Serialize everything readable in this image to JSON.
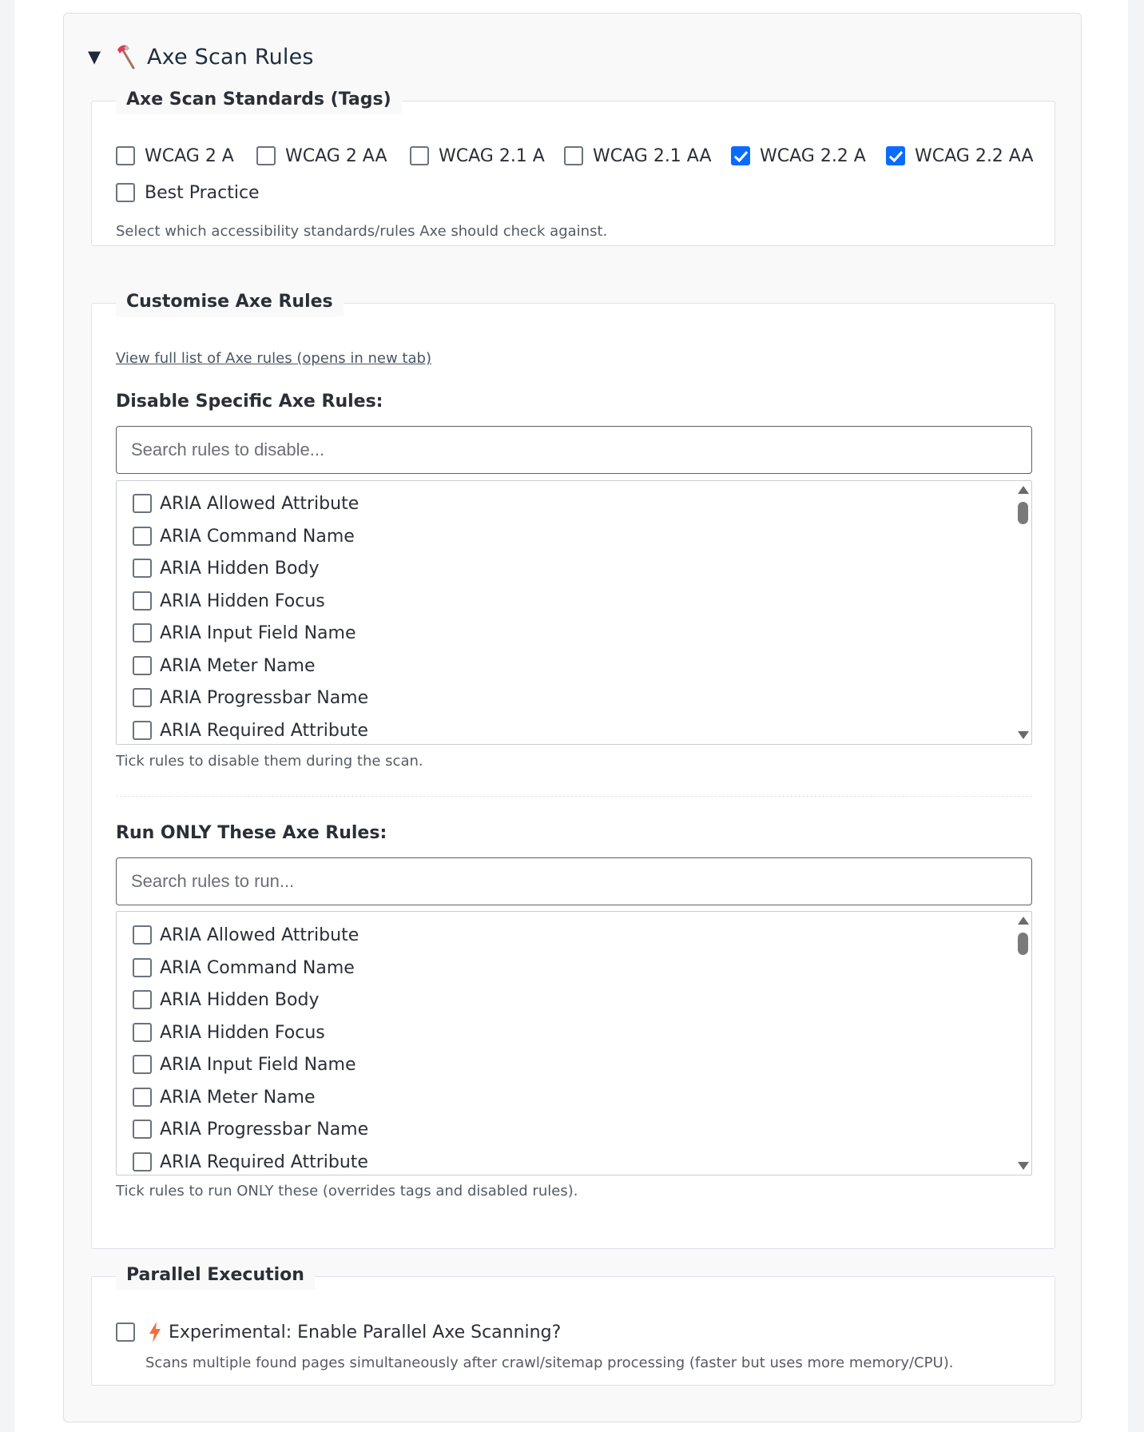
{
  "section": {
    "title": "Axe Scan Rules",
    "icon": "axe-icon",
    "expanded": true
  },
  "standards": {
    "legend": "Axe Scan Standards (Tags)",
    "tags": [
      {
        "label": "WCAG 2 A",
        "checked": false
      },
      {
        "label": "WCAG 2 AA",
        "checked": false
      },
      {
        "label": "WCAG 2.1 A",
        "checked": false
      },
      {
        "label": "WCAG 2.1 AA",
        "checked": false
      },
      {
        "label": "WCAG 2.2 A",
        "checked": true
      },
      {
        "label": "WCAG 2.2 AA",
        "checked": true
      },
      {
        "label": "Best Practice",
        "checked": false
      }
    ],
    "help": "Select which accessibility standards/rules Axe should check against."
  },
  "customise": {
    "legend": "Customise Axe Rules",
    "link_text": "View full list of Axe rules (opens in new tab)",
    "disable": {
      "heading": "Disable Specific Axe Rules:",
      "placeholder": "Search rules to disable...",
      "help": "Tick rules to disable them during the scan.",
      "rules": [
        "ARIA Allowed Attribute",
        "ARIA Command Name",
        "ARIA Hidden Body",
        "ARIA Hidden Focus",
        "ARIA Input Field Name",
        "ARIA Meter Name",
        "ARIA Progressbar Name",
        "ARIA Required Attribute"
      ]
    },
    "run_only": {
      "heading": "Run ONLY These Axe Rules:",
      "placeholder": "Search rules to run...",
      "help": "Tick rules to run ONLY these (overrides tags and disabled rules).",
      "rules": [
        "ARIA Allowed Attribute",
        "ARIA Command Name",
        "ARIA Hidden Body",
        "ARIA Hidden Focus",
        "ARIA Input Field Name",
        "ARIA Meter Name",
        "ARIA Progressbar Name",
        "ARIA Required Attribute"
      ]
    }
  },
  "parallel": {
    "legend": "Parallel Execution",
    "icon": "lightning-bolt-icon",
    "label": "Experimental: Enable Parallel Axe Scanning?",
    "checked": false,
    "help": "Scans multiple found pages simultaneously after crawl/sitemap processing (faster but uses more memory/CPU)."
  },
  "colors": {
    "accent": "#0a6cff",
    "bolt": "#f26d3d"
  }
}
